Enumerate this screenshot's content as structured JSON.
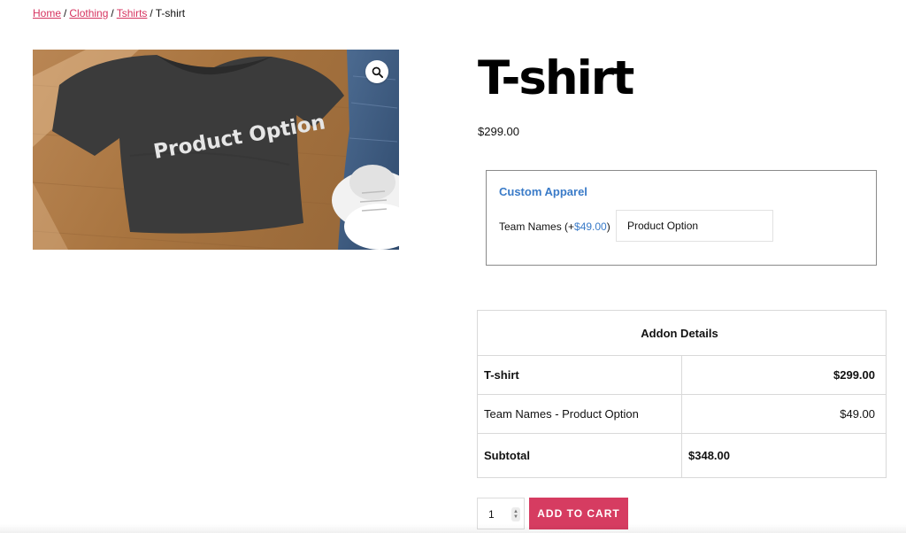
{
  "breadcrumb": {
    "home": "Home",
    "clothing": "Clothing",
    "tshirts": "Tshirts",
    "current": "T-shirt",
    "separator": "/"
  },
  "gallery": {
    "shirt_print": "Product Option",
    "zoom_icon": "magnifier-icon"
  },
  "product": {
    "title": "T-shirt",
    "price": "$299.00"
  },
  "addon": {
    "group_title": "Custom Apparel",
    "field_label": "Team Names (+",
    "field_amount": "$49.00",
    "field_label_close": ")",
    "field_value": "Product Option"
  },
  "details": {
    "header": "Addon Details",
    "rows": [
      {
        "label": "T-shirt",
        "value": "$299.00"
      },
      {
        "label": "Team Names - Product Option",
        "value": "$49.00"
      },
      {
        "label": "Subtotal",
        "value": "$348.00"
      }
    ]
  },
  "cart": {
    "quantity": "1",
    "button_label": "ADD TO CART"
  },
  "colors": {
    "accent": "#d63c61",
    "link": "#d6335f",
    "addon_blue": "#3a7bc8"
  }
}
